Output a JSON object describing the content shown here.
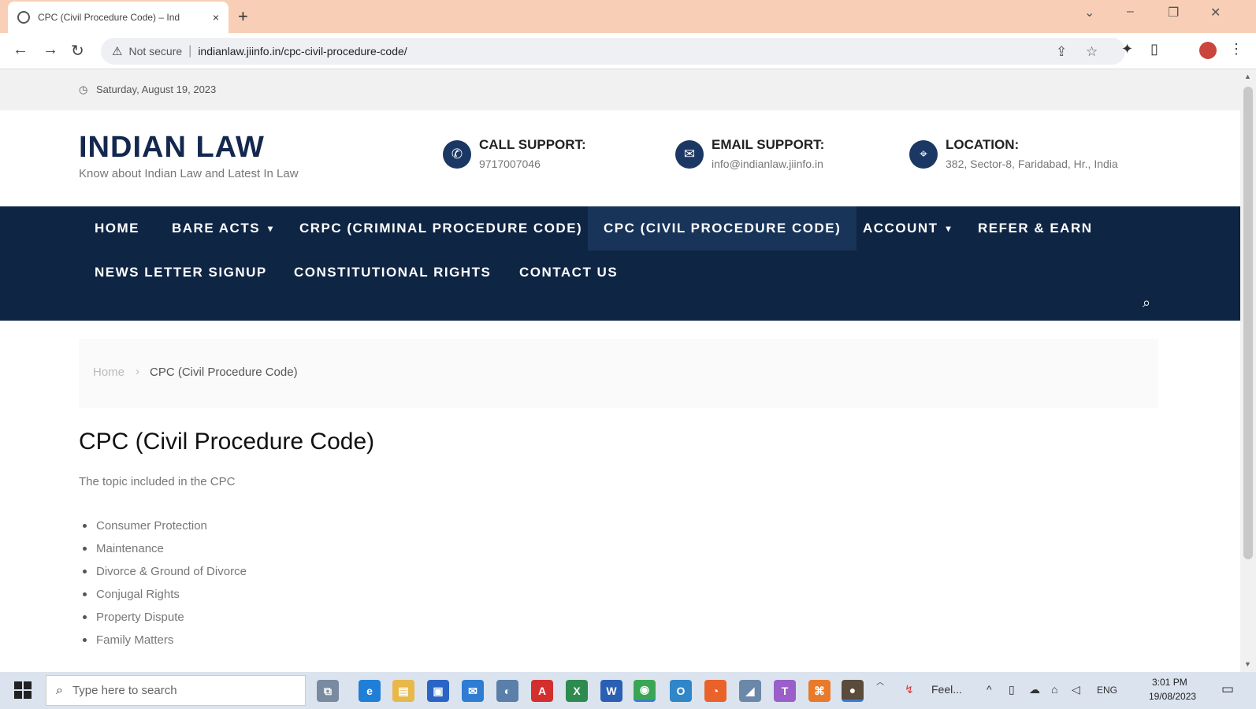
{
  "browser": {
    "tab_title": "CPC (Civil Procedure Code) – Ind",
    "tab_close": "×",
    "new_tab": "+",
    "security_label": "Not secure",
    "url": "indianlaw.jiinfo.in/cpc-civil-procedure-code/",
    "window_controls": [
      "⌄",
      "–",
      "❐",
      "✕"
    ]
  },
  "topbar": {
    "date": "Saturday, August 19, 2023"
  },
  "site": {
    "brand": "INDIAN LAW",
    "tagline": "Know about Indian Law and Latest In Law"
  },
  "contacts": [
    {
      "label": "CALL SUPPORT:",
      "value": "9717007046",
      "icon": "phone-icon"
    },
    {
      "label": "EMAIL SUPPORT:",
      "value": "info@indianlaw.jiinfo.in",
      "icon": "mail-icon"
    },
    {
      "label": "LOCATION:",
      "value": "382, Sector-8, Faridabad, Hr., India",
      "icon": "location-icon"
    }
  ],
  "nav": {
    "items": [
      {
        "label": "HOME"
      },
      {
        "label": "BARE ACTS",
        "dropdown": true
      },
      {
        "label": "CRPC (CRIMINAL PROCEDURE CODE)"
      },
      {
        "label": "CPC (CIVIL PROCEDURE CODE)",
        "active": true
      },
      {
        "label": "ACCOUNT",
        "dropdown": true
      },
      {
        "label": "REFER & EARN"
      },
      {
        "label": "NEWS LETTER SIGNUP"
      },
      {
        "label": "CONSTITUTIONAL RIGHTS"
      },
      {
        "label": "CONTACT US"
      }
    ]
  },
  "breadcrumb": {
    "home": "Home",
    "separator": "›",
    "current": "CPC (Civil Procedure Code)"
  },
  "content": {
    "title": "CPC (Civil Procedure Code)",
    "intro": "The topic included in the CPC",
    "topics": [
      "Consumer Protection",
      "Maintenance",
      "Divorce & Ground of Divorce",
      "Conjugal Rights",
      "Property Dispute",
      "Family Matters"
    ]
  },
  "taskbar": {
    "search_placeholder": "Type here to search",
    "weather_text": "Feel...",
    "language": "ENG",
    "time": "3:01 PM",
    "date": "19/08/2023"
  },
  "colors": {
    "nav_bg": "#0f2544",
    "brand": "#14274e",
    "tabbar": "#f8cfb6"
  }
}
